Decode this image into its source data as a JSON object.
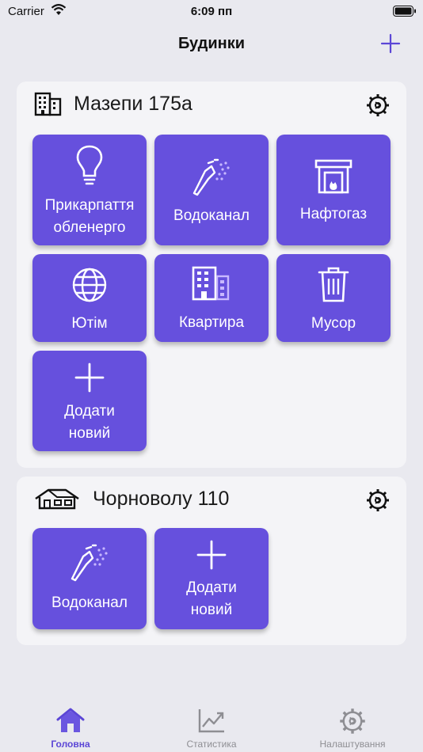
{
  "status_bar": {
    "carrier": "Carrier",
    "time": "6:09 пп"
  },
  "header": {
    "title": "Будинки"
  },
  "houses": [
    {
      "name": "Мазепи 175а",
      "tiles": [
        {
          "label_line1": "Прикарпаття",
          "label_line2": "обленерго",
          "icon": "lightbulb-icon"
        },
        {
          "label": "Водоканал",
          "icon": "water-tap-icon"
        },
        {
          "label": "Нафтогаз",
          "icon": "fireplace-icon"
        },
        {
          "label": "Ютім",
          "icon": "globe-icon"
        },
        {
          "label": "Квартира",
          "icon": "building-icon"
        },
        {
          "label": "Мусор",
          "icon": "trash-icon"
        },
        {
          "label_line1": "Додати",
          "label_line2": "новий",
          "icon": "plus-icon"
        }
      ]
    },
    {
      "name": "Чорноволу 110",
      "tiles": [
        {
          "label": "Водоканал",
          "icon": "water-tap-icon"
        },
        {
          "label_line1": "Додати",
          "label_line2": "новий",
          "icon": "plus-icon"
        }
      ]
    }
  ],
  "tabs": [
    {
      "label": "Головна",
      "icon": "home-icon",
      "active": true
    },
    {
      "label": "Статистика",
      "icon": "chart-icon",
      "active": false
    },
    {
      "label": "Налаштування",
      "icon": "gear-icon",
      "active": false
    }
  ],
  "colors": {
    "accent": "#6650dd",
    "background": "#e9e9ef",
    "card": "#f4f4f7",
    "active_tab": "#5b46d6",
    "inactive_tab": "#8e8e93"
  }
}
